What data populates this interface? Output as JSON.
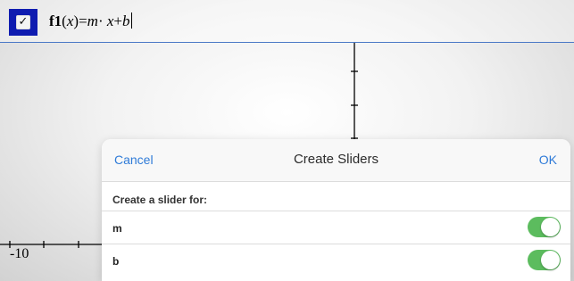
{
  "entry": {
    "checkbox_glyph": "✓",
    "function_name": "f1",
    "arg_open": "(",
    "arg": "x",
    "arg_close": ")",
    "equals": "=",
    "m": "m",
    "dot": "· ",
    "x": "x",
    "plus": "+",
    "b": "b"
  },
  "axis": {
    "x_min_label": "-10"
  },
  "dialog": {
    "cancel_label": "Cancel",
    "title": "Create Sliders",
    "ok_label": "OK",
    "section_label": "Create a slider for:",
    "sliders": [
      {
        "label": "m",
        "enabled": true
      },
      {
        "label": "b",
        "enabled": true
      }
    ]
  },
  "colors": {
    "accent": "#2f7bd8",
    "toggle_on": "#5cbc5e",
    "checkbox_bg": "#0f1cb0",
    "entry_line": "#4a78c6"
  }
}
